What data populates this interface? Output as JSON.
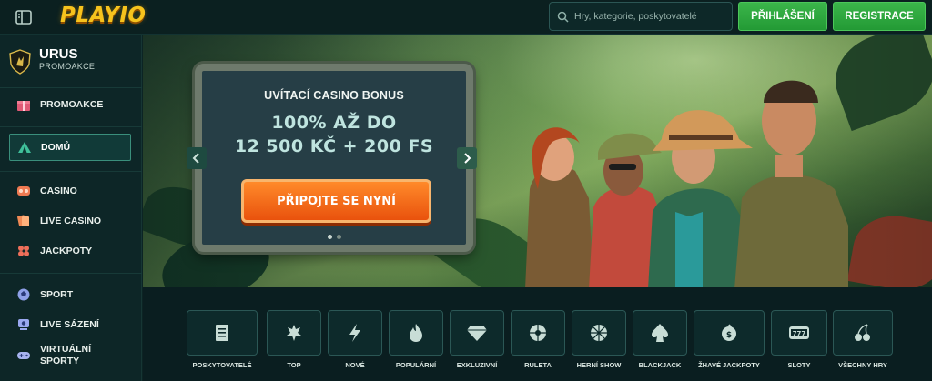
{
  "header": {
    "logo": "PLAYIO",
    "search_placeholder": "Hry, kategorie, poskytovatelé",
    "login_label": "PŘIHLÁŠENÍ",
    "register_label": "REGISTRACE"
  },
  "sidebar": {
    "promo_title": "URUS",
    "promo_sub": "PROMOAKCE",
    "items": [
      {
        "label": "PROMOAKCE",
        "icon": "gift-icon"
      },
      {
        "label": "DOMŮ",
        "icon": "tent-icon"
      },
      {
        "label": "CASINO",
        "icon": "casino-chip-icon"
      },
      {
        "label": "LIVE CASINO",
        "icon": "cards-icon"
      },
      {
        "label": "JACKPOTY",
        "icon": "clover-icon"
      },
      {
        "label": "SPORT",
        "icon": "ball-icon"
      },
      {
        "label": "LIVE SÁZENÍ",
        "icon": "live-betting-icon"
      },
      {
        "label": "VIRTUÁLNÍ SPORTY",
        "icon": "gamepad-icon"
      }
    ]
  },
  "banner": {
    "label": "UVÍTACÍ CASINO BONUS",
    "headline_1": "100% AŽ DO",
    "headline_2": "12 500 KČ + 200 FS",
    "cta": "PŘIPOJTE SE NYNÍ"
  },
  "categories": [
    {
      "label": "POSKYTOVATELÉ",
      "icon": "provider-icon"
    },
    {
      "label": "TOP",
      "icon": "top-crown-icon"
    },
    {
      "label": "NOVÉ",
      "icon": "lightning-icon"
    },
    {
      "label": "POPULÁRNÍ",
      "icon": "flame-icon"
    },
    {
      "label": "EXKLUZIVNÍ",
      "icon": "diamond-icon"
    },
    {
      "label": "RULETA",
      "icon": "roulette-icon"
    },
    {
      "label": "HERNÍ SHOW",
      "icon": "wheel-icon"
    },
    {
      "label": "BLACKJACK",
      "icon": "spade-icon"
    },
    {
      "label": "ŽHAVÉ JACKPOTY",
      "icon": "hot-jackpot-icon"
    },
    {
      "label": "SLOTY",
      "icon": "slot-777-icon"
    },
    {
      "label": "VŠECHNY HRY",
      "icon": "cherries-icon"
    }
  ],
  "colors": {
    "accent_green": "#2fa93f",
    "cta_orange": "#f26b1b",
    "background": "#0c2424",
    "logo_gold": "#f6c31d"
  }
}
